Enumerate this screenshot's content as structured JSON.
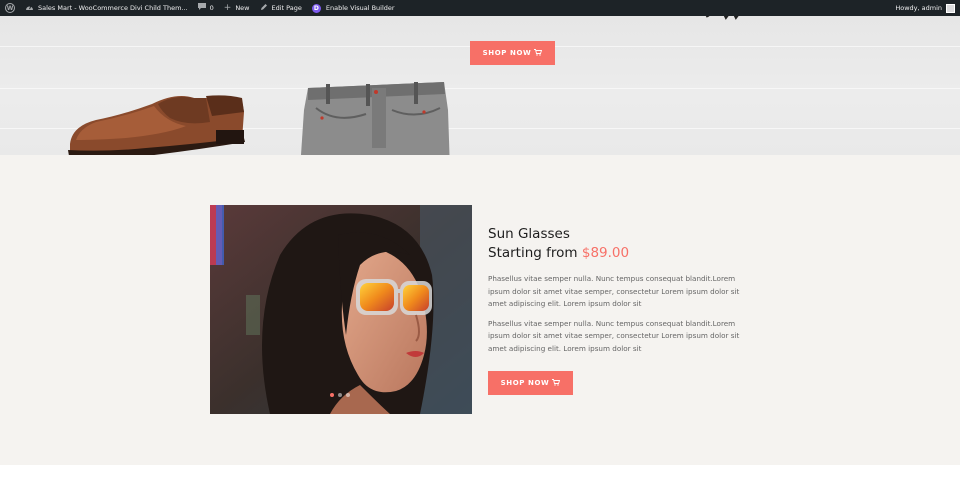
{
  "admin_bar": {
    "site_name": "Sales Mart - WooCommerce Divi Child Them...",
    "comments_count": "0",
    "new_label": "New",
    "edit_page_label": "Edit Page",
    "visual_builder_label": "Enable Visual Builder",
    "howdy_label": "Howdy, admin"
  },
  "hero": {
    "button_label": "SHOP NOW",
    "cart_icon": "cart-icon"
  },
  "promo": {
    "title": "Sun Glasses",
    "subtitle_prefix": "Starting from ",
    "price": "$89.00",
    "paragraph1": "Phasellus vitae semper nulla. Nunc tempus consequat blandit.Lorem ipsum dolor sit amet vitae semper, consectetur Lorem ipsum dolor sit amet adipiscing elit. Lorem ipsum dolor sit",
    "paragraph2": "Phasellus vitae semper nulla. Nunc tempus consequat blandit.Lorem ipsum dolor sit amet vitae semper, consectetur Lorem ipsum dolor sit amet adipiscing elit. Lorem ipsum dolor sit",
    "button_label": "SHOP NOW",
    "slider_dots": 3,
    "active_dot": 0
  },
  "colors": {
    "accent": "#f77067",
    "admin_bar_bg": "#1d2327",
    "section_bg": "#f5f3f0"
  }
}
